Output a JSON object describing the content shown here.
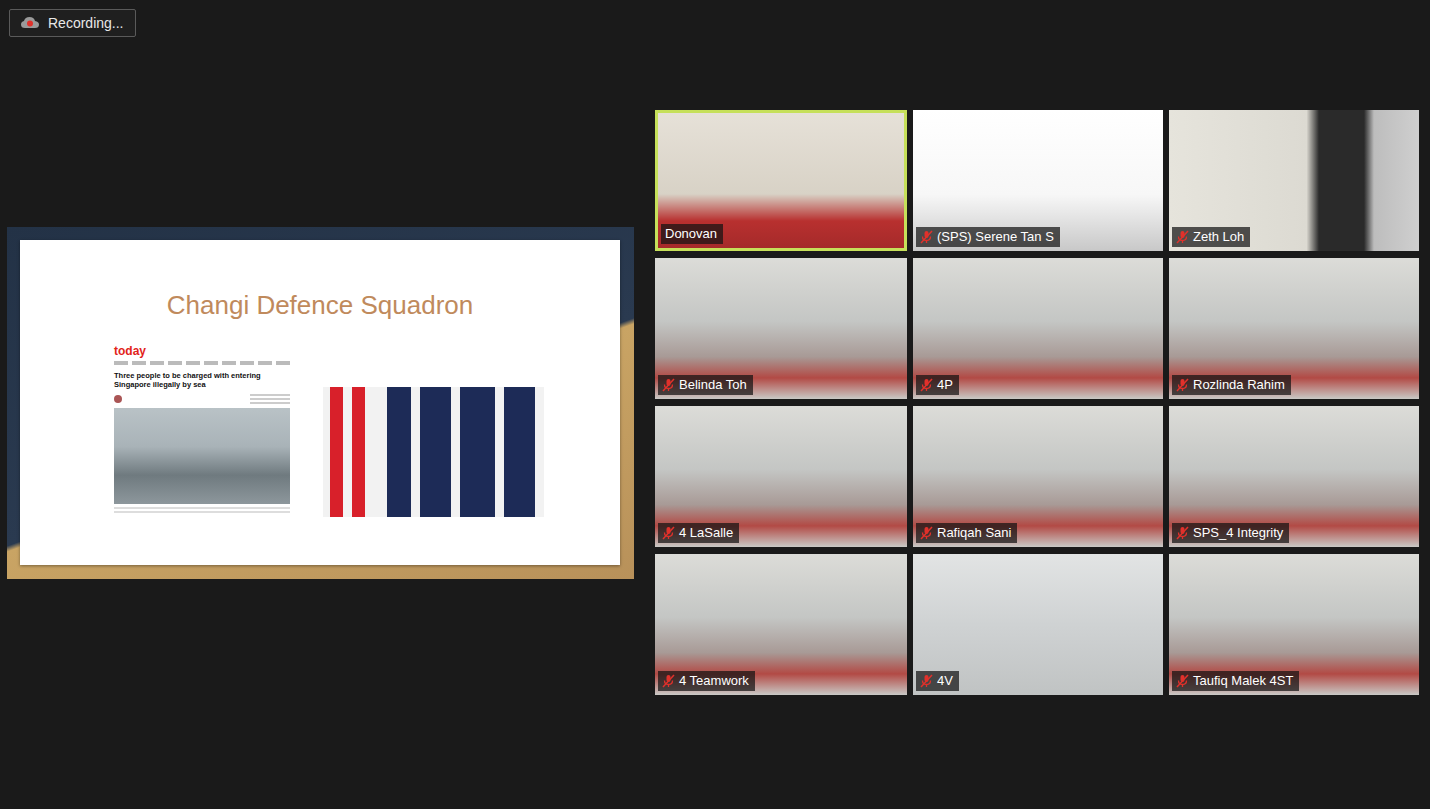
{
  "recording": {
    "label": "Recording..."
  },
  "share": {
    "slide": {
      "title": "Changi Defence Squadron",
      "article": {
        "source": "today",
        "headline": "Three people to be charged with entering Singapore illegally by sea"
      }
    }
  },
  "participants": [
    {
      "name": "Donovan",
      "muted": false,
      "speaking": true
    },
    {
      "name": "(SPS) Serene Tan S",
      "muted": true,
      "speaking": false
    },
    {
      "name": "Zeth Loh",
      "muted": true,
      "speaking": false
    },
    {
      "name": "Belinda Toh",
      "muted": true,
      "speaking": false
    },
    {
      "name": "4P",
      "muted": true,
      "speaking": false
    },
    {
      "name": "Rozlinda Rahim",
      "muted": true,
      "speaking": false
    },
    {
      "name": "4 LaSalle",
      "muted": true,
      "speaking": false
    },
    {
      "name": "Rafiqah Sani",
      "muted": true,
      "speaking": false
    },
    {
      "name": "SPS_4 Integrity",
      "muted": true,
      "speaking": false
    },
    {
      "name": "4 Teamwork",
      "muted": true,
      "speaking": false
    },
    {
      "name": "4V",
      "muted": true,
      "speaking": false
    },
    {
      "name": "Taufiq Malek 4ST",
      "muted": true,
      "speaking": false
    }
  ]
}
